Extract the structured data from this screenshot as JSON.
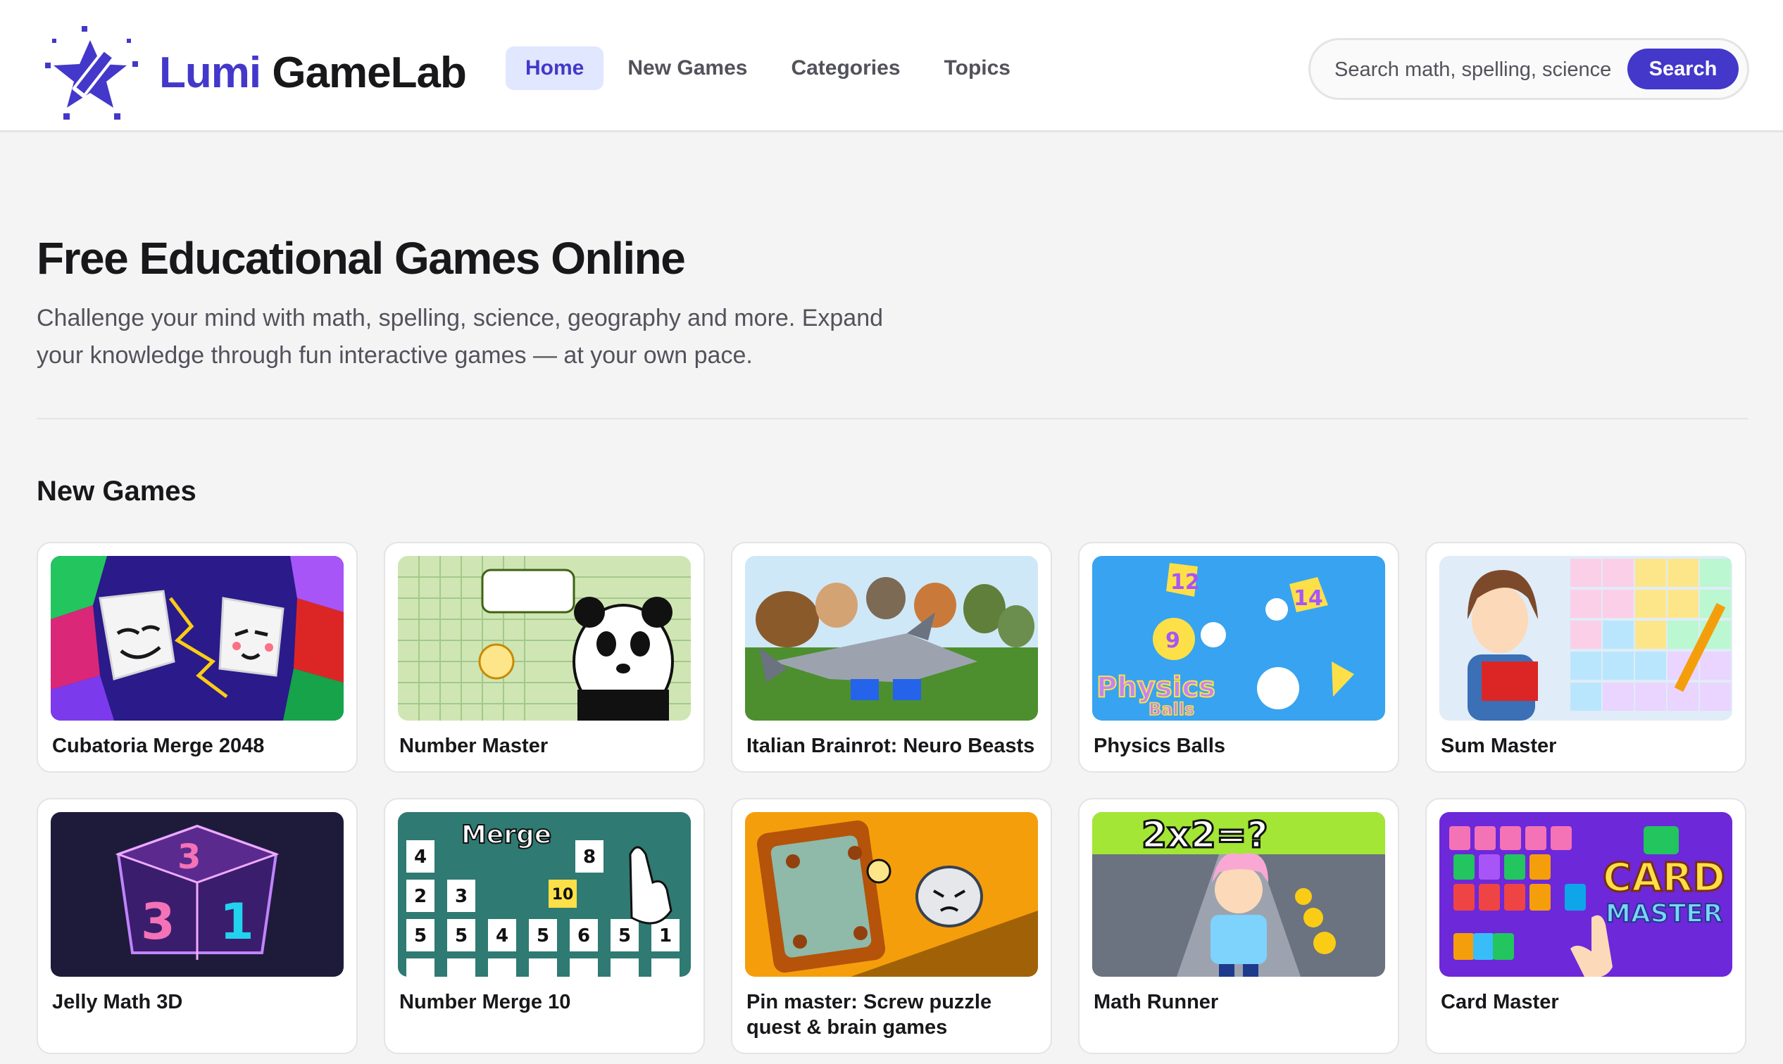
{
  "brand": {
    "name_part1": "Lumi",
    "name_part2": "GameLab",
    "accent": "#4338ca"
  },
  "nav": {
    "items": [
      {
        "label": "Home",
        "active": true
      },
      {
        "label": "New Games",
        "active": false
      },
      {
        "label": "Categories",
        "active": false
      },
      {
        "label": "Topics",
        "active": false
      }
    ]
  },
  "search": {
    "placeholder": "Search math, spelling, science...",
    "button_label": "Search"
  },
  "hero": {
    "title": "Free Educational Games Online",
    "subtitle": "Challenge your mind with math, spelling, science, geography and more. Expand your knowledge through fun interactive games — at your own pace."
  },
  "new_games": {
    "heading": "New Games",
    "games": [
      {
        "title": "Cubatoria Merge 2048",
        "art": "cubes"
      },
      {
        "title": "Number Master",
        "art": "panda"
      },
      {
        "title": "Italian Brainrot: Neuro Beasts",
        "art": "beasts"
      },
      {
        "title": "Physics Balls",
        "art": "physics"
      },
      {
        "title": "Sum Master",
        "art": "summaster"
      },
      {
        "title": "Jelly Math 3D",
        "art": "jelly"
      },
      {
        "title": "Number Merge 10",
        "art": "merge10"
      },
      {
        "title": "Pin master: Screw puzzle quest & brain games",
        "art": "pin"
      },
      {
        "title": "Math Runner",
        "art": "runner"
      },
      {
        "title": "Card Master",
        "art": "card"
      }
    ]
  }
}
